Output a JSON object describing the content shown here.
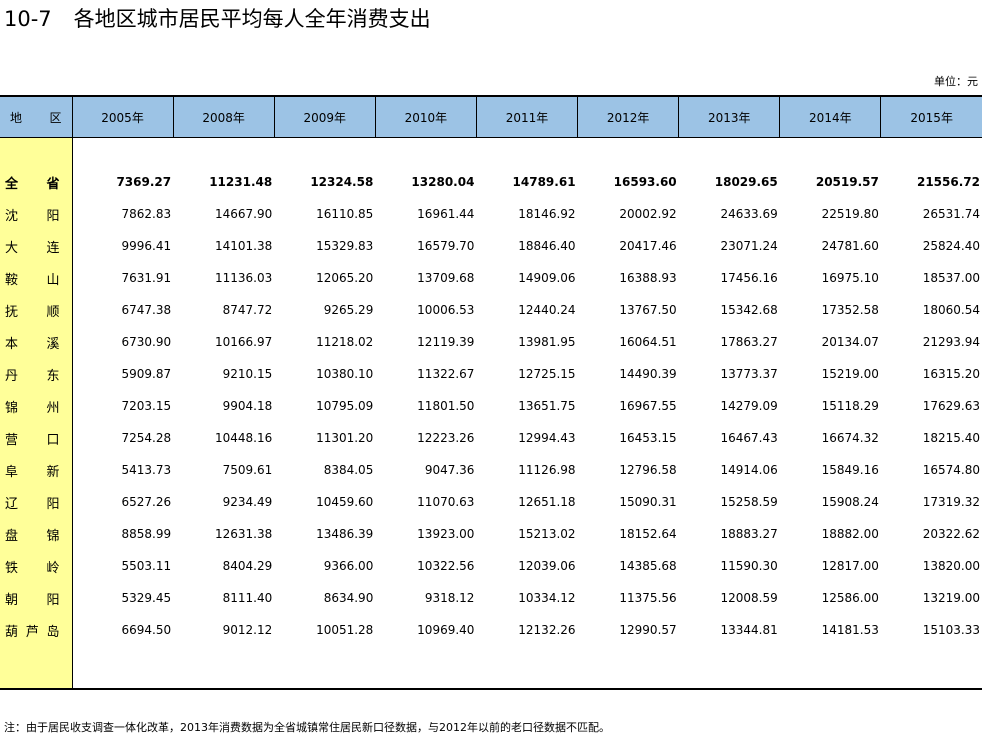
{
  "title": {
    "number": "10-7",
    "text": "各地区城市居民平均每人全年消费支出"
  },
  "unit": "单位：元",
  "table": {
    "region_header": [
      "地",
      "区"
    ],
    "years": [
      "2005年",
      "2008年",
      "2009年",
      "2010年",
      "2011年",
      "2012年",
      "2013年",
      "2014年",
      "2015年"
    ],
    "rows": [
      {
        "region": [
          "全",
          "省"
        ],
        "total": true,
        "values": [
          "7369.27",
          "11231.48",
          "12324.58",
          "13280.04",
          "14789.61",
          "16593.60",
          "18029.65",
          "20519.57",
          "21556.72"
        ]
      },
      {
        "region": [
          "沈",
          "阳"
        ],
        "values": [
          "7862.83",
          "14667.90",
          "16110.85",
          "16961.44",
          "18146.92",
          "20002.92",
          "24633.69",
          "22519.80",
          "26531.74"
        ]
      },
      {
        "region": [
          "大",
          "连"
        ],
        "values": [
          "9996.41",
          "14101.38",
          "15329.83",
          "16579.70",
          "18846.40",
          "20417.46",
          "23071.24",
          "24781.60",
          "25824.40"
        ]
      },
      {
        "region": [
          "鞍",
          "山"
        ],
        "values": [
          "7631.91",
          "11136.03",
          "12065.20",
          "13709.68",
          "14909.06",
          "16388.93",
          "17456.16",
          "16975.10",
          "18537.00"
        ]
      },
      {
        "region": [
          "抚",
          "顺"
        ],
        "values": [
          "6747.38",
          "8747.72",
          "9265.29",
          "10006.53",
          "12440.24",
          "13767.50",
          "15342.68",
          "17352.58",
          "18060.54"
        ]
      },
      {
        "region": [
          "本",
          "溪"
        ],
        "values": [
          "6730.90",
          "10166.97",
          "11218.02",
          "12119.39",
          "13981.95",
          "16064.51",
          "17863.27",
          "20134.07",
          "21293.94"
        ]
      },
      {
        "region": [
          "丹",
          "东"
        ],
        "values": [
          "5909.87",
          "9210.15",
          "10380.10",
          "11322.67",
          "12725.15",
          "14490.39",
          "13773.37",
          "15219.00",
          "16315.20"
        ]
      },
      {
        "region": [
          "锦",
          "州"
        ],
        "values": [
          "7203.15",
          "9904.18",
          "10795.09",
          "11801.50",
          "13651.75",
          "16967.55",
          "14279.09",
          "15118.29",
          "17629.63"
        ]
      },
      {
        "region": [
          "营",
          "口"
        ],
        "values": [
          "7254.28",
          "10448.16",
          "11301.20",
          "12223.26",
          "12994.43",
          "16453.15",
          "16467.43",
          "16674.32",
          "18215.40"
        ]
      },
      {
        "region": [
          "阜",
          "新"
        ],
        "values": [
          "5413.73",
          "7509.61",
          "8384.05",
          "9047.36",
          "11126.98",
          "12796.58",
          "14914.06",
          "15849.16",
          "16574.80"
        ]
      },
      {
        "region": [
          "辽",
          "阳"
        ],
        "values": [
          "6527.26",
          "9234.49",
          "10459.60",
          "11070.63",
          "12651.18",
          "15090.31",
          "15258.59",
          "15908.24",
          "17319.32"
        ]
      },
      {
        "region": [
          "盘",
          "锦"
        ],
        "values": [
          "8858.99",
          "12631.38",
          "13486.39",
          "13923.00",
          "15213.02",
          "18152.64",
          "18883.27",
          "18882.00",
          "20322.62"
        ]
      },
      {
        "region": [
          "铁",
          "岭"
        ],
        "values": [
          "5503.11",
          "8404.29",
          "9366.00",
          "10322.56",
          "12039.06",
          "14385.68",
          "11590.30",
          "12817.00",
          "13820.00"
        ]
      },
      {
        "region": [
          "朝",
          "阳"
        ],
        "values": [
          "5329.45",
          "8111.40",
          "8634.90",
          "9318.12",
          "10334.12",
          "11375.56",
          "12008.59",
          "12586.00",
          "13219.00"
        ]
      },
      {
        "region": [
          "葫",
          "芦",
          "岛"
        ],
        "values": [
          "6694.50",
          "9012.12",
          "10051.28",
          "10969.40",
          "12132.26",
          "12990.57",
          "13344.81",
          "14181.53",
          "15103.33"
        ]
      }
    ]
  },
  "note": "注：由于居民收支调查一体化改革，2013年消费数据为全省城镇常住居民新口径数据，与2012年以前的老口径数据不匹配。",
  "colors": {
    "header_bg": "#9cc3e5",
    "region_bg": "#ffff99"
  }
}
